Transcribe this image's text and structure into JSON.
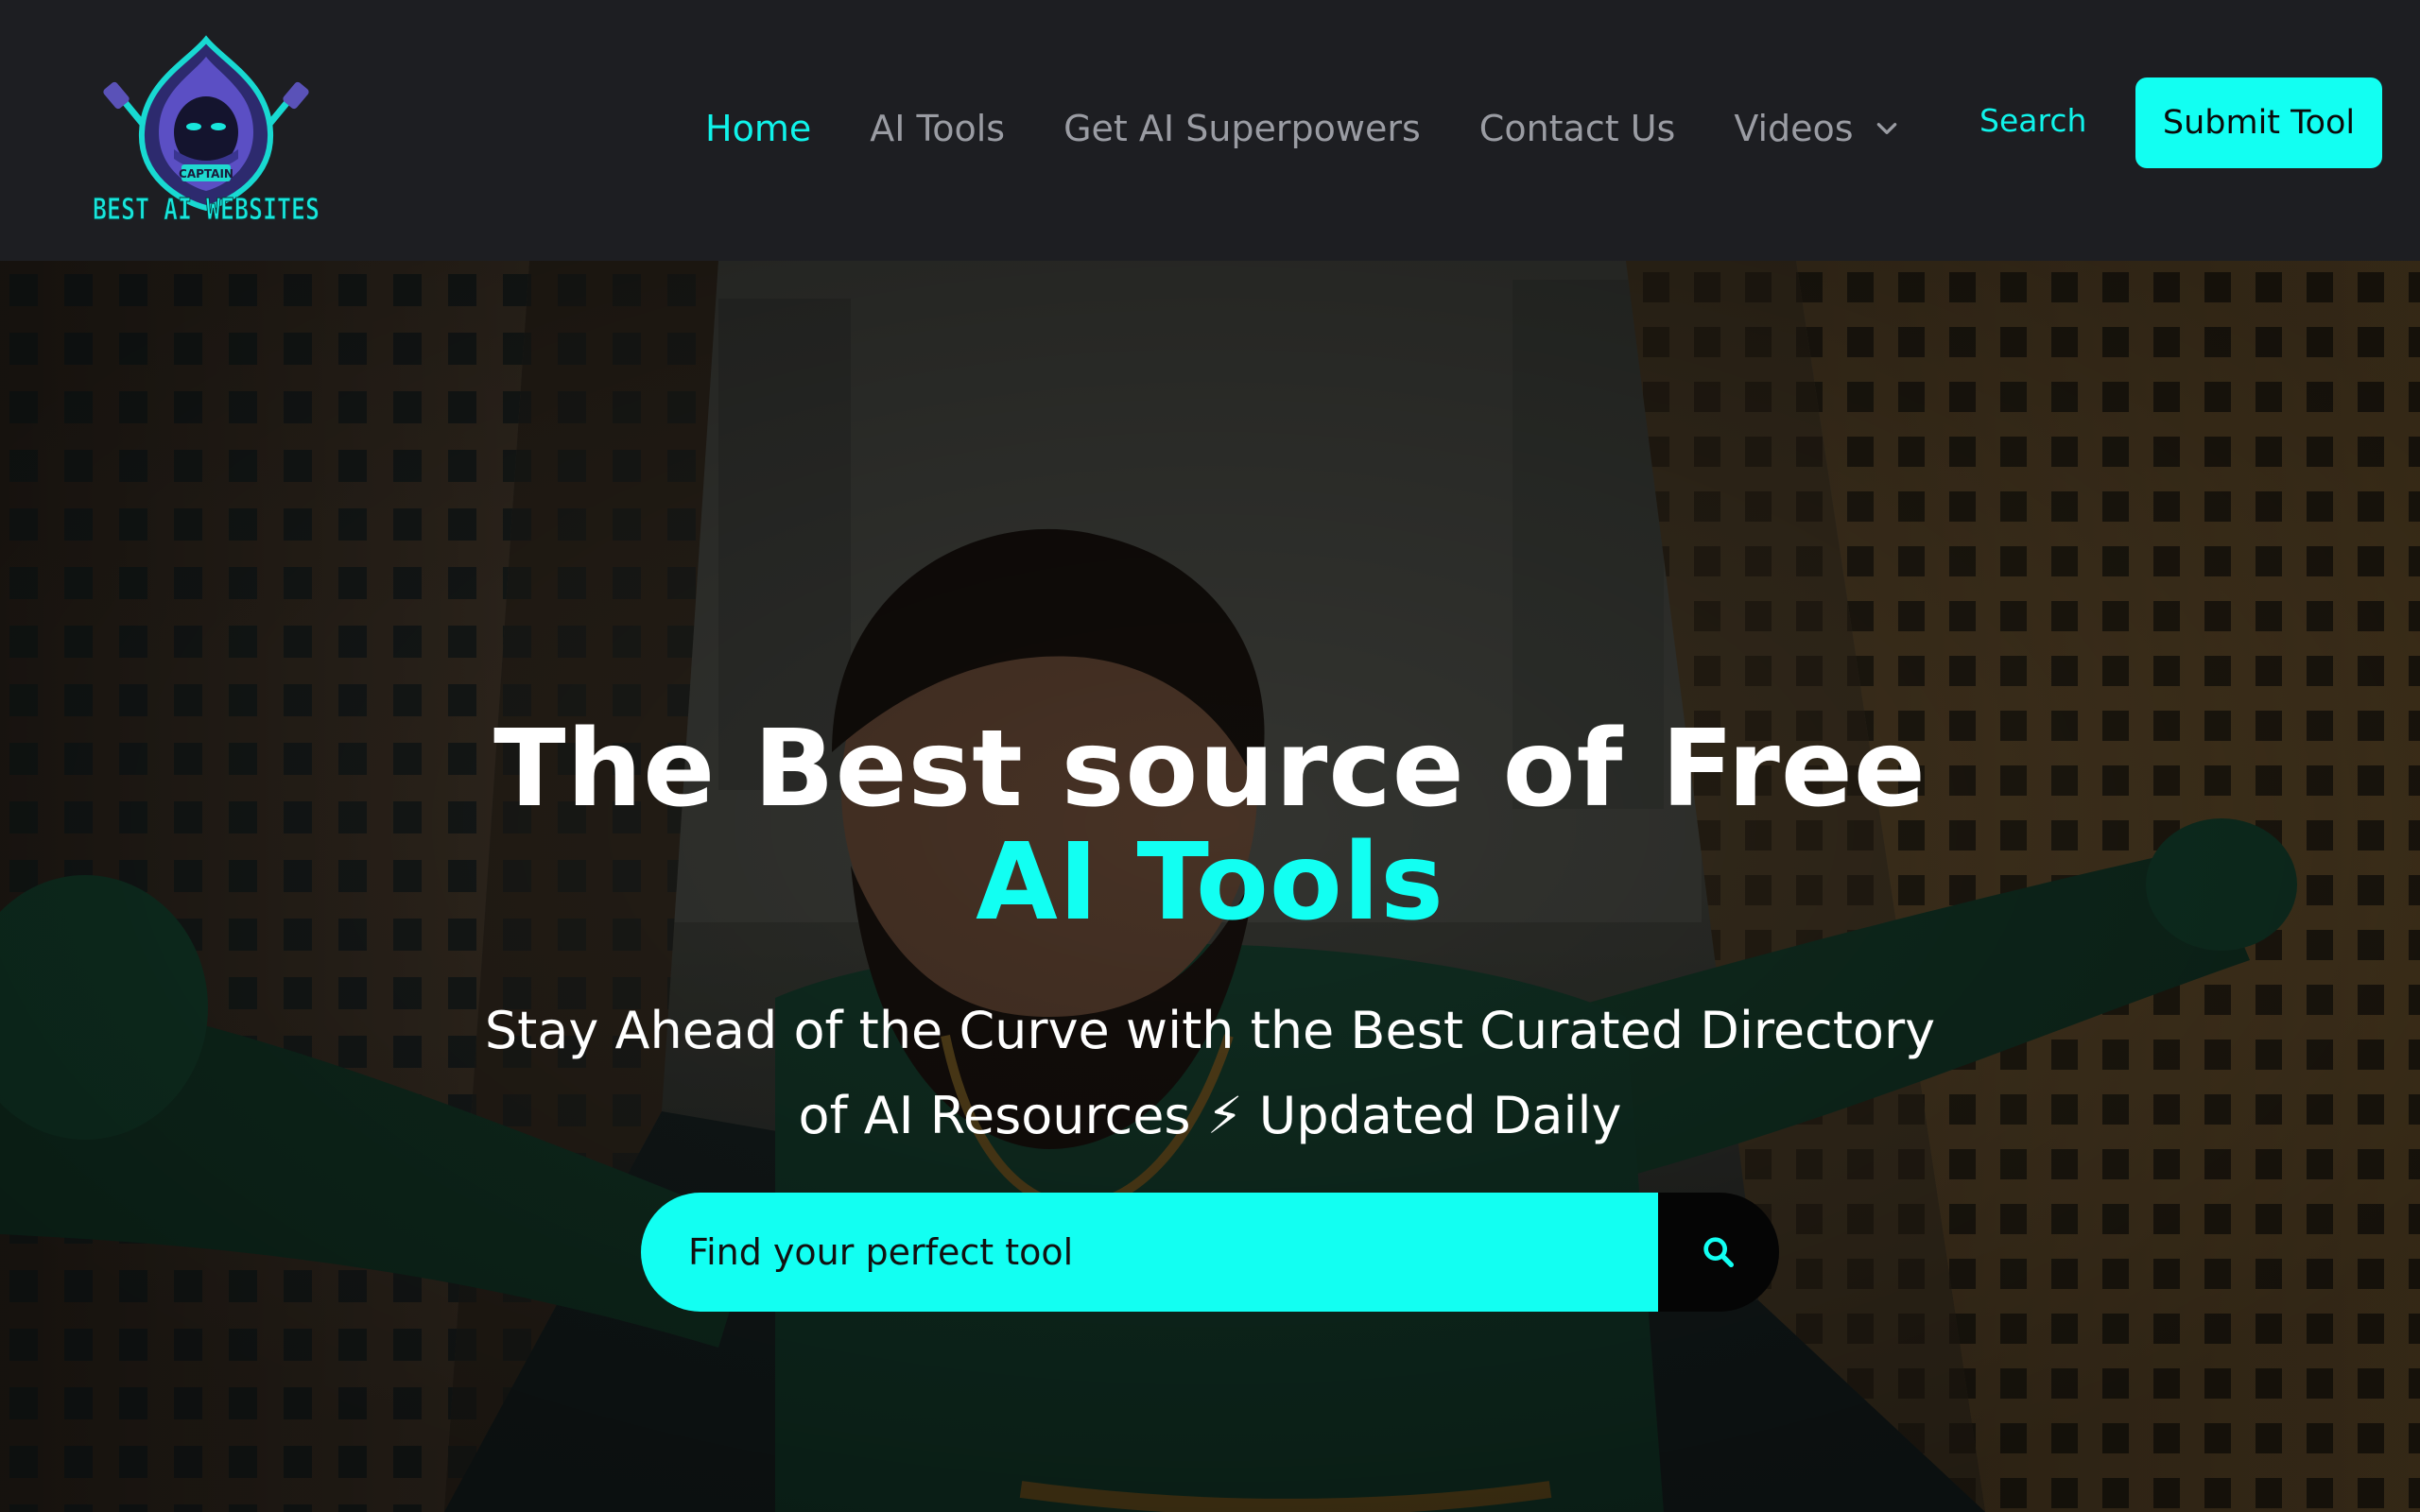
{
  "brand": {
    "logo_top": "CAPTAIN",
    "logo_bottom": "BEST AI WEBSITES",
    "accent_color": "#12fff2",
    "header_bg": "#1d1e22"
  },
  "nav": {
    "items": [
      {
        "label": "Home",
        "active": true
      },
      {
        "label": "AI Tools",
        "active": false
      },
      {
        "label": "Get AI Superpowers",
        "active": false
      },
      {
        "label": "Contact Us",
        "active": false
      },
      {
        "label": "Videos",
        "active": false,
        "has_dropdown": true
      }
    ],
    "search_label": "Search",
    "submit_label": "Submit Tool"
  },
  "hero": {
    "title_line1": "The Best source of Free",
    "title_line2": "AI Tools",
    "subtitle_line1": "Stay Ahead of the Curve with the Best Curated Directory",
    "subtitle_line2": "of AI Resources ⚡ Updated Daily",
    "search": {
      "placeholder": "Find your perfect tool",
      "icon": "search-icon"
    }
  }
}
